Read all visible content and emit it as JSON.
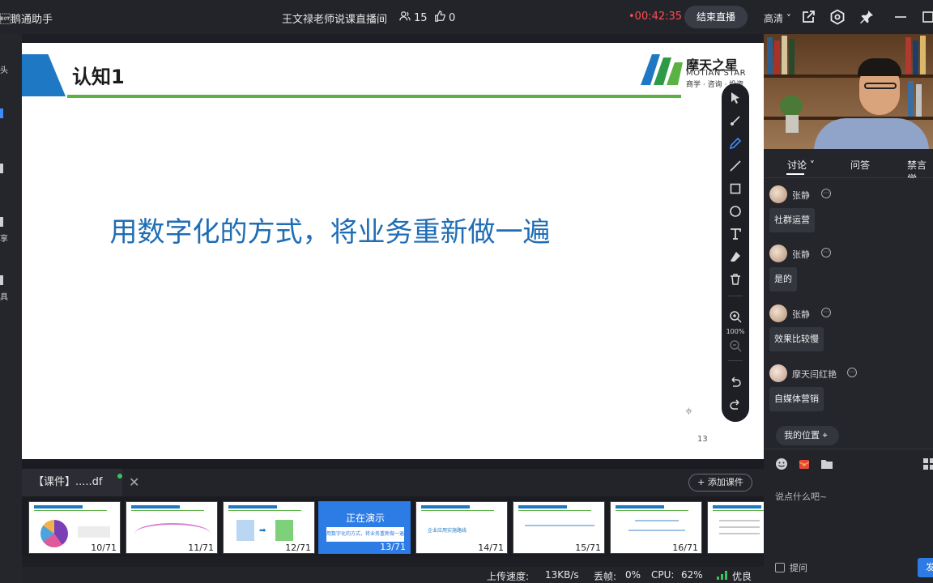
{
  "header": {
    "app_name": "小鹅通助手",
    "app_name_visible": "\u0004鹅通助手",
    "room_title": "王文禄老师说课直播间",
    "viewers": "15",
    "likes": "0",
    "timer": "•00:42:35",
    "end_live_label": "结束直播",
    "quality": "高清 ˅"
  },
  "leftbar": {
    "items": [
      "头",
      "",
      "",
      "享",
      "具"
    ]
  },
  "slide": {
    "title": "认知1",
    "body": "用数字化的方式，将业务重新做一遍",
    "page_number": "13",
    "logo": {
      "cn": "摩天之星",
      "en": "MOTIAN STAR",
      "sub": "商学 · 咨询 · 投资"
    }
  },
  "toolbar": {
    "zoom": "100%",
    "tools": [
      "select-icon",
      "laser-icon",
      "pen-icon",
      "line-icon",
      "rect-icon",
      "circle-icon",
      "text-icon",
      "eraser-icon",
      "trash-icon",
      "zoom-in-icon",
      "zoom-out-icon",
      "undo-icon",
      "redo-icon"
    ]
  },
  "files": {
    "current_file": "【课件】.....df",
    "add_course_label": "+ 添加课件"
  },
  "thumbnails": [
    {
      "label": "10/71",
      "current": false
    },
    {
      "label": "11/71",
      "current": false
    },
    {
      "label": "12/71",
      "current": false
    },
    {
      "label": "13/71",
      "current": true,
      "status": "正在演示",
      "sub": "用数字化的方式，将业务重新做一遍"
    },
    {
      "label": "14/71",
      "current": false,
      "sub": "企业应用实施路线"
    },
    {
      "label": "15/71",
      "current": false
    },
    {
      "label": "16/71",
      "current": false
    },
    {
      "label": "",
      "current": false
    }
  ],
  "status": {
    "upload_label": "上传速度:",
    "upload_value": "13KB/s",
    "drop_label": "丢帧:",
    "drop_value": "0%",
    "cpu_label": "CPU:",
    "cpu_value": "62%",
    "network": "优良"
  },
  "panel": {
    "tabs": [
      "讨论 ˅",
      "问答",
      "禁言学"
    ],
    "messages": [
      {
        "user": "张静",
        "text": "社群运营"
      },
      {
        "user": "张静",
        "text": "是的"
      },
      {
        "user": "张静",
        "text": "效果比较慢"
      },
      {
        "user": "摩天闫红艳",
        "text": "自媒体营销"
      }
    ],
    "my_position": "我的位置",
    "input_placeholder": "说点什么吧~",
    "ask_label": "提问",
    "send_label": "发"
  },
  "colors": {
    "accent": "#2d7be5",
    "timer": "#ff4d4f",
    "slide_text": "#1f6db5",
    "slide_rule": "#5bb243"
  }
}
